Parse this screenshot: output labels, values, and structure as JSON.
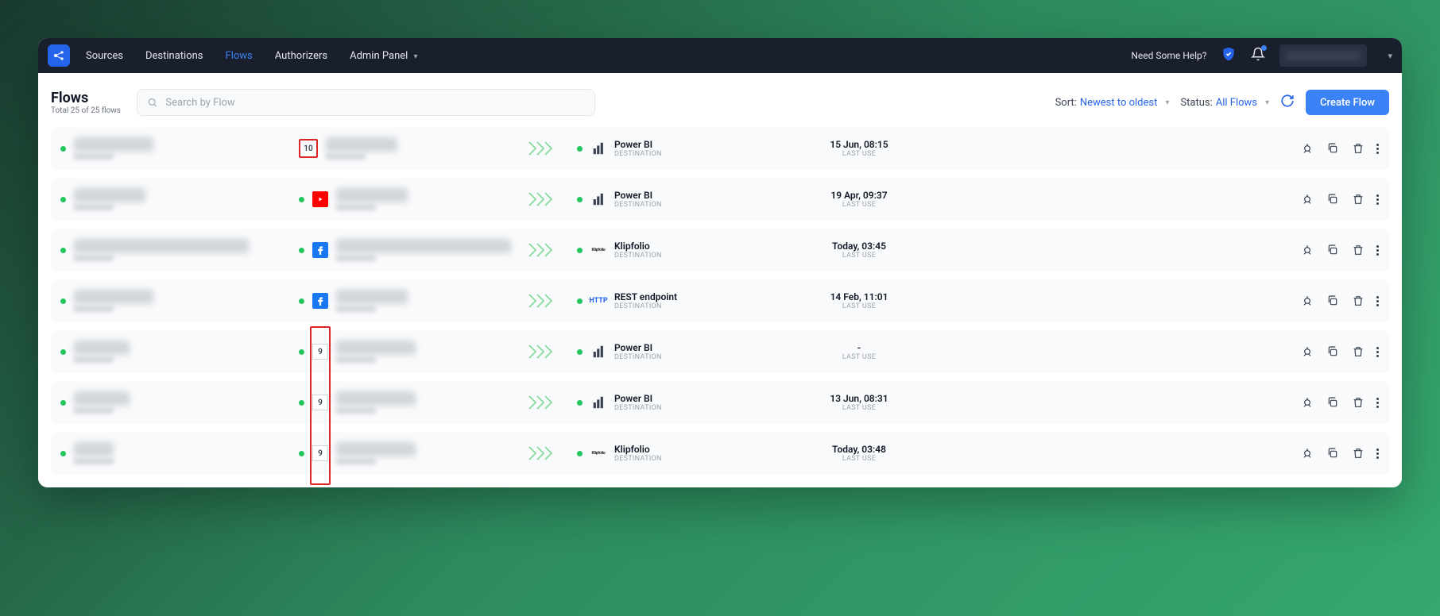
{
  "nav": {
    "items": [
      {
        "label": "Sources",
        "active": false
      },
      {
        "label": "Destinations",
        "active": false
      },
      {
        "label": "Flows",
        "active": true
      },
      {
        "label": "Authorizers",
        "active": false
      },
      {
        "label": "Admin Panel",
        "active": false,
        "dropdown": true
      }
    ],
    "help_label": "Need Some Help?"
  },
  "page": {
    "title": "Flows",
    "subtitle": "Total 25 of 25 flows",
    "search_placeholder": "Search by Flow",
    "sort_label": "Sort:",
    "sort_value": "Newest to oldest",
    "status_label": "Status:",
    "status_value": "All Flows",
    "create_btn": "Create Flow"
  },
  "rows": [
    {
      "status": "active",
      "source_type": "number",
      "source_number": "10",
      "source_red_box": true,
      "dest_status": "active",
      "dest_icon": "powerbi",
      "dest_name": "Power BI",
      "dest_sub": "DESTINATION",
      "time": "15 Jun, 08:15",
      "time_sub": "LAST USE"
    },
    {
      "status": "active",
      "source_type": "youtube",
      "source_status": "active",
      "dest_status": "active",
      "dest_icon": "powerbi",
      "dest_name": "Power BI",
      "dest_sub": "DESTINATION",
      "time": "19 Apr, 09:37",
      "time_sub": "LAST USE"
    },
    {
      "status": "active",
      "source_type": "facebook",
      "source_status": "active",
      "dest_status": "active",
      "dest_icon": "klipfolio",
      "dest_name": "Klipfolio",
      "dest_sub": "DESTINATION",
      "time": "Today, 03:45",
      "time_sub": "LAST USE"
    },
    {
      "status": "active",
      "source_type": "facebook",
      "source_status": "active",
      "dest_status": "active",
      "dest_icon": "http",
      "dest_name": "REST endpoint",
      "dest_sub": "DESTINATION",
      "time": "14 Feb, 11:01",
      "time_sub": "LAST USE"
    },
    {
      "status": "active",
      "source_type": "number",
      "source_number": "9",
      "source_status": "active",
      "tall_red_start": true,
      "dest_status": "active",
      "dest_icon": "powerbi",
      "dest_name": "Power BI",
      "dest_sub": "DESTINATION",
      "time": "-",
      "time_sub": "LAST USE"
    },
    {
      "status": "active",
      "source_type": "number",
      "source_number": "9",
      "source_status": "active",
      "dest_status": "active",
      "dest_icon": "powerbi",
      "dest_name": "Power BI",
      "dest_sub": "DESTINATION",
      "time": "13 Jun, 08:31",
      "time_sub": "LAST USE"
    },
    {
      "status": "active",
      "source_type": "number",
      "source_number": "9",
      "source_status": "active",
      "dest_status": "active",
      "dest_icon": "klipfolio",
      "dest_name": "Klipfolio",
      "dest_sub": "DESTINATION",
      "time": "Today, 03:48",
      "time_sub": "LAST USE"
    }
  ]
}
